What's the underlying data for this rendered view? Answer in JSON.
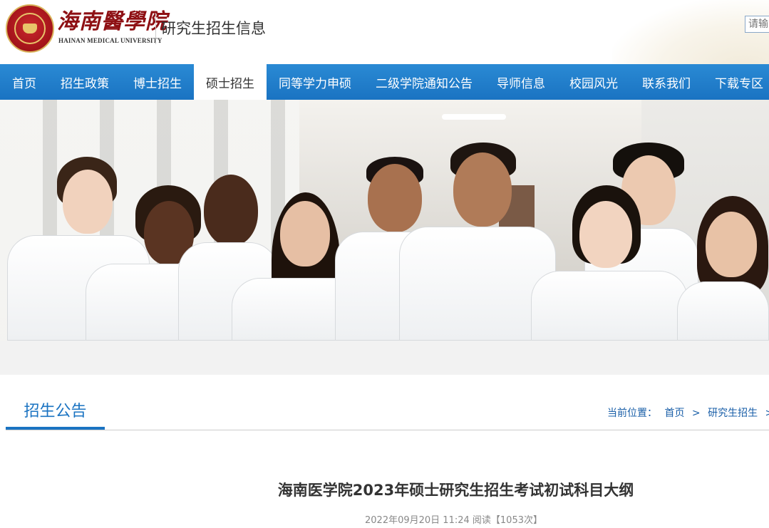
{
  "header": {
    "logo_name": "海南醫學院",
    "logo_sub": "HAINAN MEDICAL UNIVERSITY",
    "site_title": "研究生招生信息",
    "search_placeholder": "请输"
  },
  "nav": {
    "items": [
      {
        "label": "首页"
      },
      {
        "label": "招生政策"
      },
      {
        "label": "博士招生"
      },
      {
        "label": "硕士招生",
        "active": true
      },
      {
        "label": "同等学力申硕"
      },
      {
        "label": "二级学院通知公告"
      },
      {
        "label": "导师信息"
      },
      {
        "label": "校园风光"
      },
      {
        "label": "联系我们"
      },
      {
        "label": "下载专区"
      }
    ]
  },
  "section": {
    "title": "招生公告"
  },
  "breadcrumb": {
    "prefix": "当前位置：",
    "items": [
      "首页",
      "研究生招生"
    ],
    "separator": ">"
  },
  "article": {
    "title": "海南医学院2023年硕士研究生招生考试初试科目大纲",
    "meta": "2022年09月20日 11:24 阅读【1053次】"
  },
  "colors": {
    "nav_blue": "#1a73c2",
    "brand_red": "#8e1014",
    "accent_blue": "#1a73c2"
  }
}
